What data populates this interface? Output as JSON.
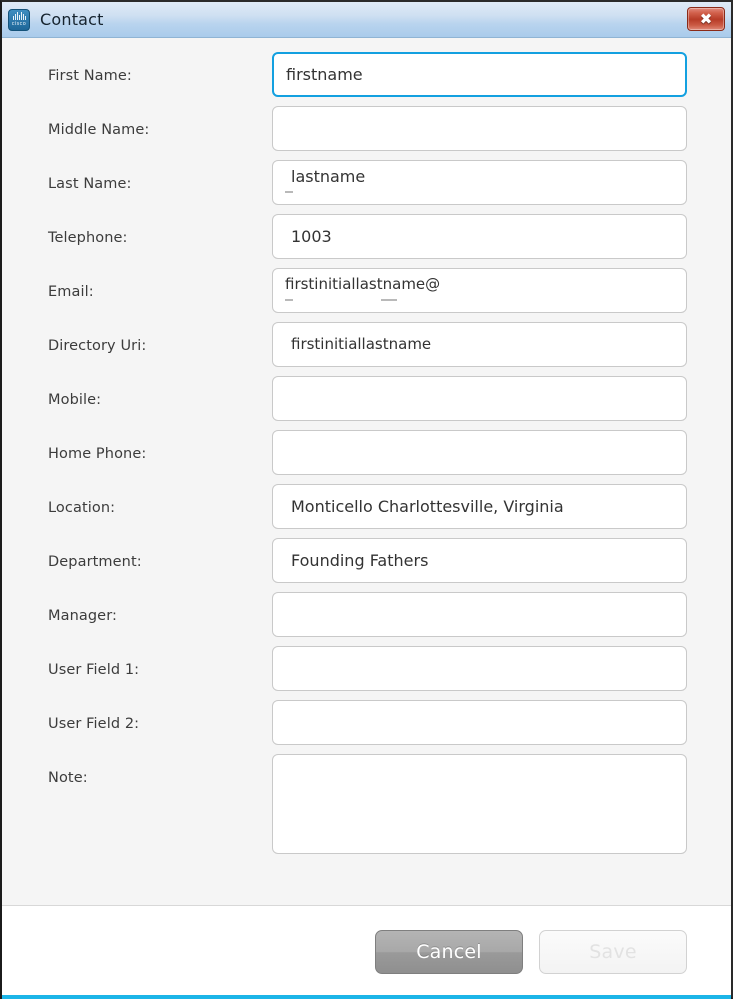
{
  "window": {
    "title": "Contact",
    "app_icon": "cisco-logo-icon",
    "cisco_wordmark": "cisco",
    "close_label": "✖",
    "close_icon": "close-icon",
    "accent_color": "#1cb5e8",
    "focus_color": "#13a0e0",
    "titlebar_gradient_top": "#dfeaf6",
    "titlebar_gradient_bottom": "#a9cbeb"
  },
  "form": {
    "fields": [
      {
        "label": "First Name:",
        "value": "firstname",
        "placeholder": "",
        "focused": true,
        "type": "text"
      },
      {
        "label": "Middle Name:",
        "value": "",
        "placeholder": "",
        "focused": false,
        "type": "text"
      },
      {
        "label": "Last Name:",
        "value": "lastname",
        "placeholder": "",
        "focused": false,
        "type": "text"
      },
      {
        "label": "Telephone:",
        "value": "1003",
        "placeholder": "",
        "focused": false,
        "type": "text"
      },
      {
        "label": "Email:",
        "value": "firstinitiallastname@",
        "placeholder": "",
        "focused": false,
        "type": "text"
      },
      {
        "label": "Directory Uri:",
        "value": "firstinitiallastname",
        "placeholder": "",
        "focused": false,
        "type": "text"
      },
      {
        "label": "Mobile:",
        "value": "",
        "placeholder": "",
        "focused": false,
        "type": "text"
      },
      {
        "label": "Home Phone:",
        "value": "",
        "placeholder": "",
        "focused": false,
        "type": "text"
      },
      {
        "label": "Location:",
        "value": "Monticello Charlottesville, Virginia",
        "placeholder": "",
        "focused": false,
        "type": "text"
      },
      {
        "label": "Department:",
        "value": "Founding Fathers",
        "placeholder": "",
        "focused": false,
        "type": "text"
      },
      {
        "label": "Manager:",
        "value": "",
        "placeholder": "",
        "focused": false,
        "type": "text"
      },
      {
        "label": "User Field 1:",
        "value": "",
        "placeholder": "",
        "focused": false,
        "type": "text"
      },
      {
        "label": "User Field 2:",
        "value": "",
        "placeholder": "",
        "focused": false,
        "type": "text"
      },
      {
        "label": "Note:",
        "value": "",
        "placeholder": "",
        "focused": false,
        "type": "textarea"
      }
    ]
  },
  "footer": {
    "cancel_label": "Cancel",
    "save_label": "Save",
    "save_enabled": false
  }
}
